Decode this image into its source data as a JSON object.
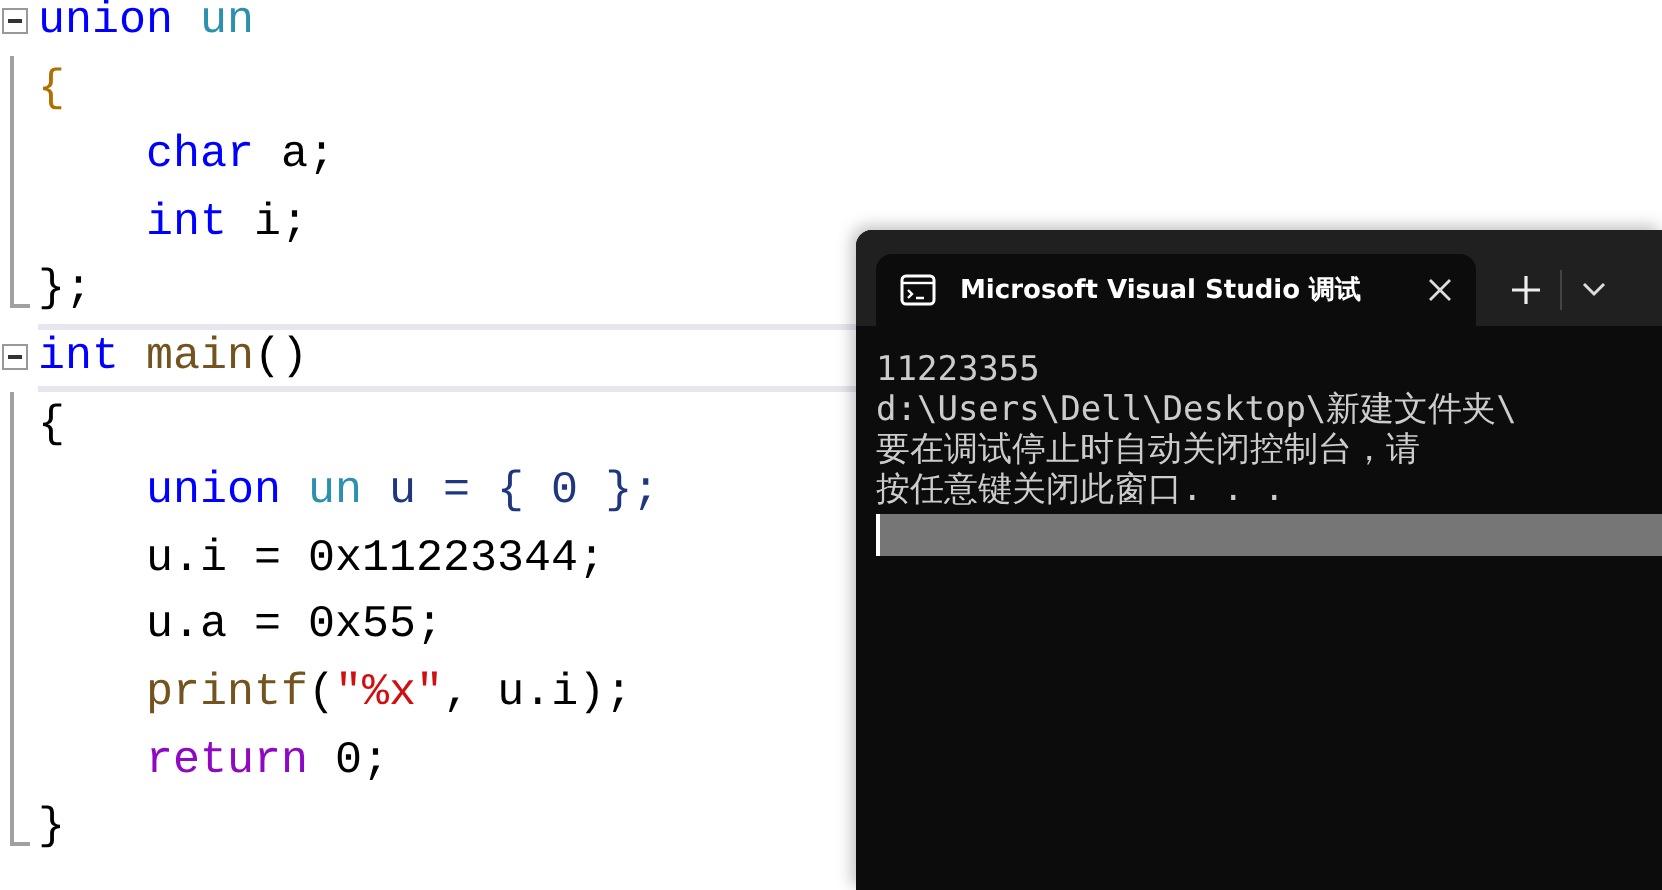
{
  "editor": {
    "lines": [
      {
        "foldable": true,
        "current": false,
        "tokens": [
          {
            "text": "union",
            "kind": "keyword"
          },
          {
            "text": " un",
            "kind": "type"
          }
        ]
      },
      {
        "foldable": false,
        "current": false,
        "tokens": [
          {
            "text": "{",
            "kind": "brace"
          }
        ]
      },
      {
        "foldable": false,
        "current": false,
        "tokens": [
          {
            "text": "    char",
            "kind": "keyword"
          },
          {
            "text": " a;",
            "kind": "plain"
          }
        ]
      },
      {
        "foldable": false,
        "current": false,
        "tokens": [
          {
            "text": "    int",
            "kind": "keyword"
          },
          {
            "text": " i;",
            "kind": "plain"
          }
        ]
      },
      {
        "foldable": false,
        "current": false,
        "tokens": [
          {
            "text": "};",
            "kind": "plain"
          }
        ]
      },
      {
        "foldable": true,
        "current": true,
        "tokens": [
          {
            "text": "int",
            "kind": "keyword"
          },
          {
            "text": " main",
            "kind": "func"
          },
          {
            "text": "()",
            "kind": "plain"
          }
        ]
      },
      {
        "foldable": false,
        "current": false,
        "tokens": [
          {
            "text": "{",
            "kind": "plain"
          }
        ]
      },
      {
        "foldable": false,
        "current": false,
        "tokens": [
          {
            "text": "    union",
            "kind": "keyword"
          },
          {
            "text": " un",
            "kind": "type"
          },
          {
            "text": " u = { 0 };",
            "kind": "variable"
          }
        ]
      },
      {
        "foldable": false,
        "current": false,
        "tokens": [
          {
            "text": "    u.i = 0x11223344;",
            "kind": "plain"
          }
        ]
      },
      {
        "foldable": false,
        "current": false,
        "tokens": [
          {
            "text": "    u.a = 0x55;",
            "kind": "plain"
          }
        ]
      },
      {
        "foldable": false,
        "current": false,
        "tokens": [
          {
            "text": "    printf",
            "kind": "func"
          },
          {
            "text": "(",
            "kind": "plain"
          },
          {
            "text": "\"%x\"",
            "kind": "string"
          },
          {
            "text": ", u.i);",
            "kind": "plain"
          }
        ]
      },
      {
        "foldable": false,
        "current": false,
        "tokens": [
          {
            "text": "    return",
            "kind": "control"
          },
          {
            "text": " 0;",
            "kind": "plain"
          }
        ]
      },
      {
        "foldable": false,
        "current": false,
        "tokens": [
          {
            "text": "}",
            "kind": "plain"
          }
        ]
      }
    ]
  },
  "console": {
    "tab": {
      "title": "Microsoft Visual Studio 调试",
      "selected": true
    },
    "output": [
      "11223355",
      "d:\\Users\\Dell\\Desktop\\新建文件夹\\",
      "要在调试停止时自动关闭控制台，请",
      "按任意键关闭此窗口. . ."
    ]
  }
}
